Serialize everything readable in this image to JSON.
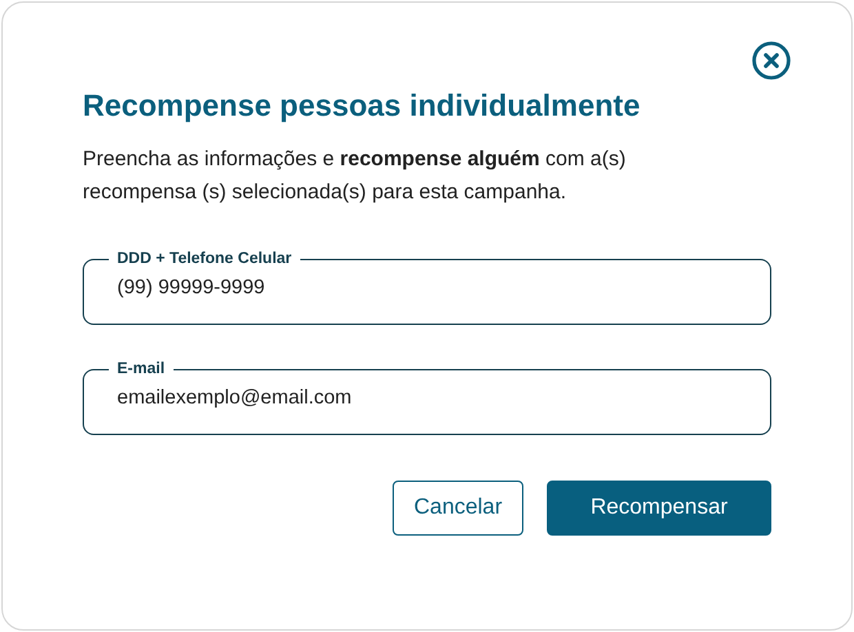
{
  "dialog": {
    "title": "Recompense pessoas individualmente",
    "description": "Preencha as informações e **recompense alguém** com a(s) recompensa (s) selecionada(s) para esta campanha.",
    "fields": [
      {
        "label": "DDD + Telefone Celular",
        "value": "(99) 99999-9999"
      },
      {
        "label": "E-mail",
        "value": "emailexemplo@email.com"
      }
    ],
    "buttons": [
      {
        "label": "Cancelar",
        "kind": "secondary"
      },
      {
        "label": "Recompensar",
        "kind": "primary"
      }
    ]
  }
}
